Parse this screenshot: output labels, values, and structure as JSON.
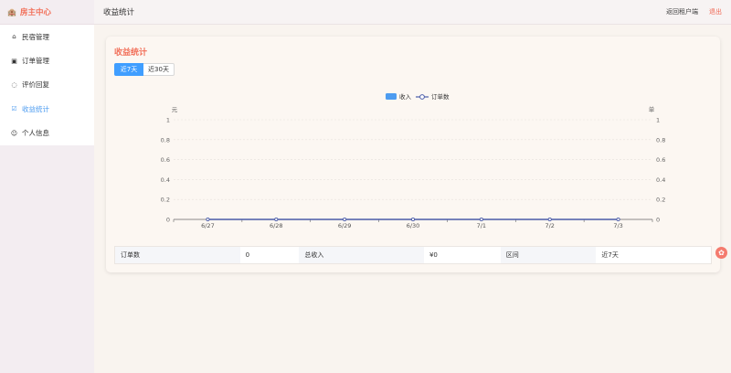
{
  "brand": {
    "icon": "building-icon",
    "title": "房主中心",
    "color": "#f2705a"
  },
  "sidebar": {
    "items": [
      {
        "icon": "home-icon",
        "label": "民宿管理",
        "active": false
      },
      {
        "icon": "clipboard-icon",
        "label": "订单管理",
        "active": false
      },
      {
        "icon": "comment-icon",
        "label": "评价回复",
        "active": false
      },
      {
        "icon": "checkbox-icon",
        "label": "收益统计",
        "active": true
      },
      {
        "icon": "user-icon",
        "label": "个人信息",
        "active": false
      }
    ]
  },
  "header": {
    "title": "收益统计",
    "back_label": "返回租户端",
    "logout_label": "退出"
  },
  "card": {
    "title": "收益统计",
    "tabs": [
      {
        "label": "近7天",
        "active": true
      },
      {
        "label": "近30天",
        "active": false
      }
    ]
  },
  "chart_data": {
    "type": "line",
    "categories": [
      "6/27",
      "6/28",
      "6/29",
      "6/30",
      "7/1",
      "7/2",
      "7/3"
    ],
    "series": [
      {
        "name": "收入",
        "type": "bar",
        "values": [
          0,
          0,
          0,
          0,
          0,
          0,
          0
        ],
        "color": "#4d9cf0"
      },
      {
        "name": "订单数",
        "type": "line",
        "values": [
          0,
          0,
          0,
          0,
          0,
          0,
          0
        ],
        "color": "#4a5ba8"
      }
    ],
    "y_left": {
      "unit": "元",
      "ticks": [
        "0",
        "0.2",
        "0.4",
        "0.6",
        "0.8",
        "1"
      ],
      "range": [
        0,
        1
      ]
    },
    "y_right": {
      "unit": "单",
      "ticks": [
        "0",
        "0.2",
        "0.4",
        "0.6",
        "0.8",
        "1"
      ],
      "range": [
        0,
        1
      ]
    },
    "legend_position": "top-center",
    "grid": true
  },
  "summary": {
    "orders_label": "订单数",
    "orders_value": "0",
    "income_label": "总收入",
    "income_value": "¥0",
    "range_label": "区间",
    "range_value": "近7天"
  },
  "floating": {
    "icon": "flower-icon",
    "glyph": "✿"
  }
}
